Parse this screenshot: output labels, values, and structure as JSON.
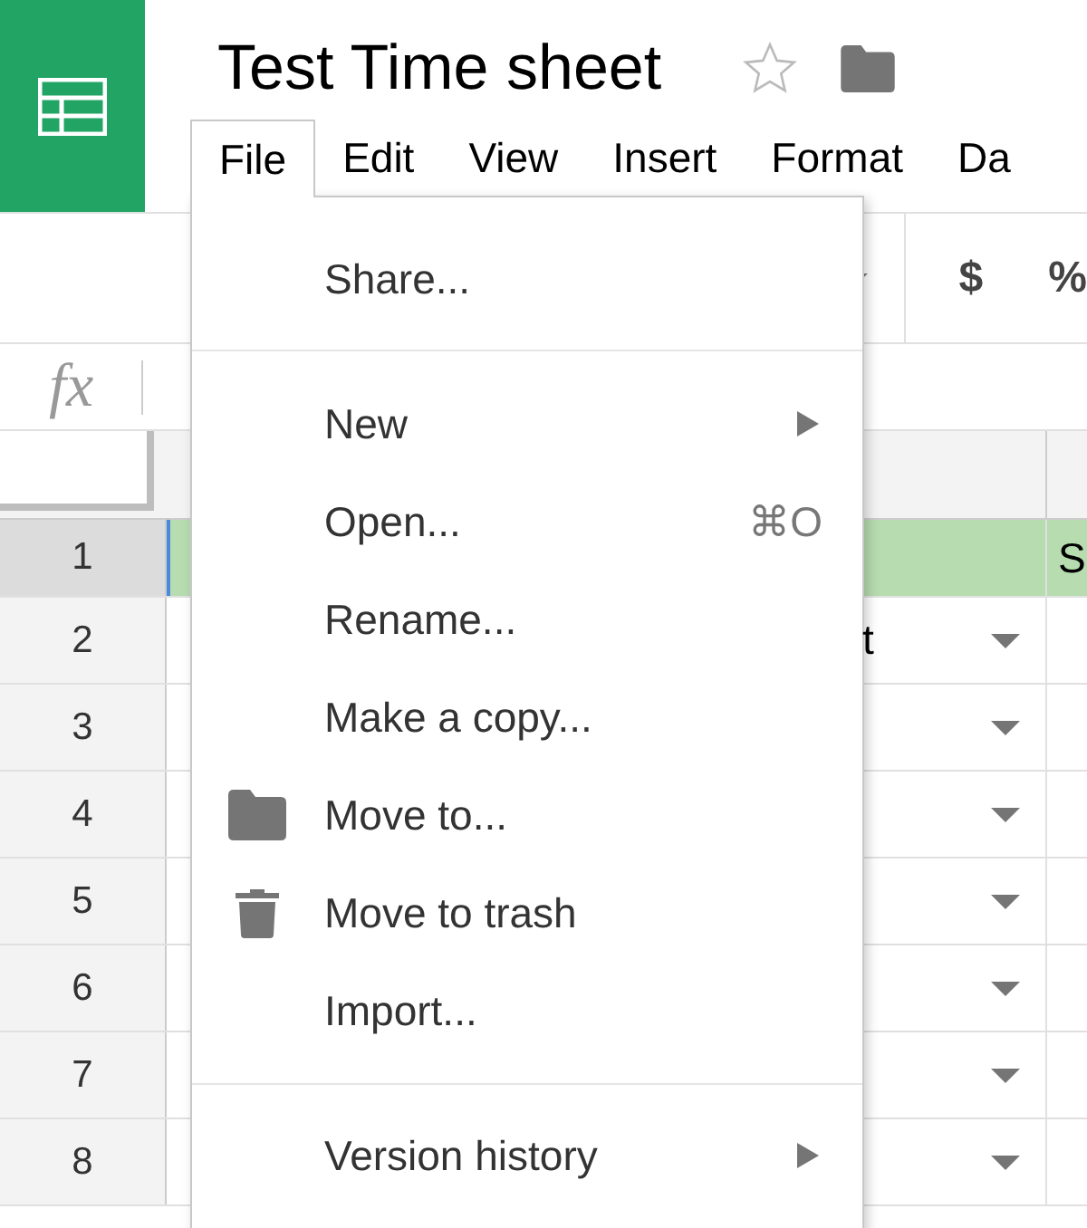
{
  "document": {
    "title": "Test Time sheet",
    "starred": false
  },
  "menubar": [
    {
      "label": "File",
      "selected": true
    },
    {
      "label": "Edit",
      "selected": false
    },
    {
      "label": "View",
      "selected": false
    },
    {
      "label": "Insert",
      "selected": false
    },
    {
      "label": "Format",
      "selected": false
    },
    {
      "label": "Da",
      "selected": false
    }
  ],
  "toolbar": {
    "currency": "$",
    "percent": "%"
  },
  "formula_bar": {
    "label": "fx"
  },
  "grid": {
    "rows": [
      {
        "header": "1",
        "selected": true,
        "highlighted": true,
        "column_b": "",
        "column_c": "S",
        "dropdown": false
      },
      {
        "header": "2",
        "selected": false,
        "highlighted": false,
        "column_b": "t",
        "column_c": "",
        "dropdown": true
      },
      {
        "header": "3",
        "selected": false,
        "highlighted": false,
        "column_b": "",
        "column_c": "",
        "dropdown": true
      },
      {
        "header": "4",
        "selected": false,
        "highlighted": false,
        "column_b": "",
        "column_c": "",
        "dropdown": true
      },
      {
        "header": "5",
        "selected": false,
        "highlighted": false,
        "column_b": "",
        "column_c": "",
        "dropdown": true
      },
      {
        "header": "6",
        "selected": false,
        "highlighted": false,
        "column_b": "",
        "column_c": "",
        "dropdown": true
      },
      {
        "header": "7",
        "selected": false,
        "highlighted": false,
        "column_b": "",
        "column_c": "",
        "dropdown": true
      },
      {
        "header": "8",
        "selected": false,
        "highlighted": false,
        "column_b": "",
        "column_c": "",
        "dropdown": true
      }
    ]
  },
  "file_menu": {
    "groups": [
      [
        {
          "label": "Share...",
          "kind": "plain",
          "submenu": false
        }
      ],
      [
        {
          "label": "New",
          "kind": "plain",
          "submenu": true
        },
        {
          "label": "Open...",
          "kind": "plain",
          "submenu": false,
          "shortcut": "⌘O"
        },
        {
          "label": "Rename...",
          "kind": "plain",
          "submenu": false
        },
        {
          "label": "Make a copy...",
          "kind": "plain",
          "submenu": false
        },
        {
          "label": "Move to...",
          "kind": "move",
          "submenu": false
        },
        {
          "label": "Move to trash",
          "kind": "delete",
          "submenu": false
        },
        {
          "label": "Import...",
          "kind": "plain",
          "submenu": false
        }
      ],
      [
        {
          "label": "Version history",
          "kind": "plain",
          "submenu": true
        }
      ]
    ]
  }
}
